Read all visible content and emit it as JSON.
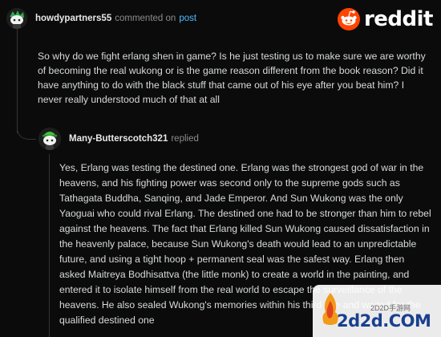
{
  "brand": {
    "logo_word": "reddit",
    "accent": "#ff4500"
  },
  "post_comment": {
    "username": "howdypartners55",
    "action": "commented on",
    "link_text": "post",
    "body": "So why do we fight erlang shen in game? Is he just testing us to make sure we are worthy of becoming the real wukong or is the game reason different from the book reason? Did it have anything to do with the black stuff that came out of his eye after you beat him? I never really understood much of that at all"
  },
  "reply": {
    "username": "Many-Butterscotch321",
    "action": "replied",
    "body": "Yes, Erlang was testing the destined one. Erlang was the strongest god of war in the heavens, and his fighting power was second only to the supreme gods such as Tathagata Buddha, Sanqing, and Jade Emperor. And Sun Wukong was the only Yaoguai who could rival Erlang. The destined one had to be stronger than him to rebel against the heavens. The fact that Erlang killed Sun Wukong caused dissatisfaction in the heavenly palace, because Sun Wukong's death would lead to an unpredictable future, and using a tight hoop + permanent seal was the safest way. Erlang then asked Maitreya Bodhisattva (the little monk) to create a world in the painting, and entered it to isolate himself from the real world to escape the surveillance of the heavens. He also sealed Wukong's memories within his third eye and waited for the qualified destined one"
  },
  "watermark": {
    "top_text": "2D2D手游网",
    "main_text": "2d2d.COM"
  },
  "colors": {
    "background": "#0b0b0b",
    "text": "#d7dadc",
    "muted": "#8a8c8e",
    "link": "#4fbcff"
  },
  "icons": {
    "avatar1": "snoo-avatar-green-hair",
    "avatar2": "snoo-avatar-green-hat",
    "logo": "reddit-snoo-icon"
  }
}
